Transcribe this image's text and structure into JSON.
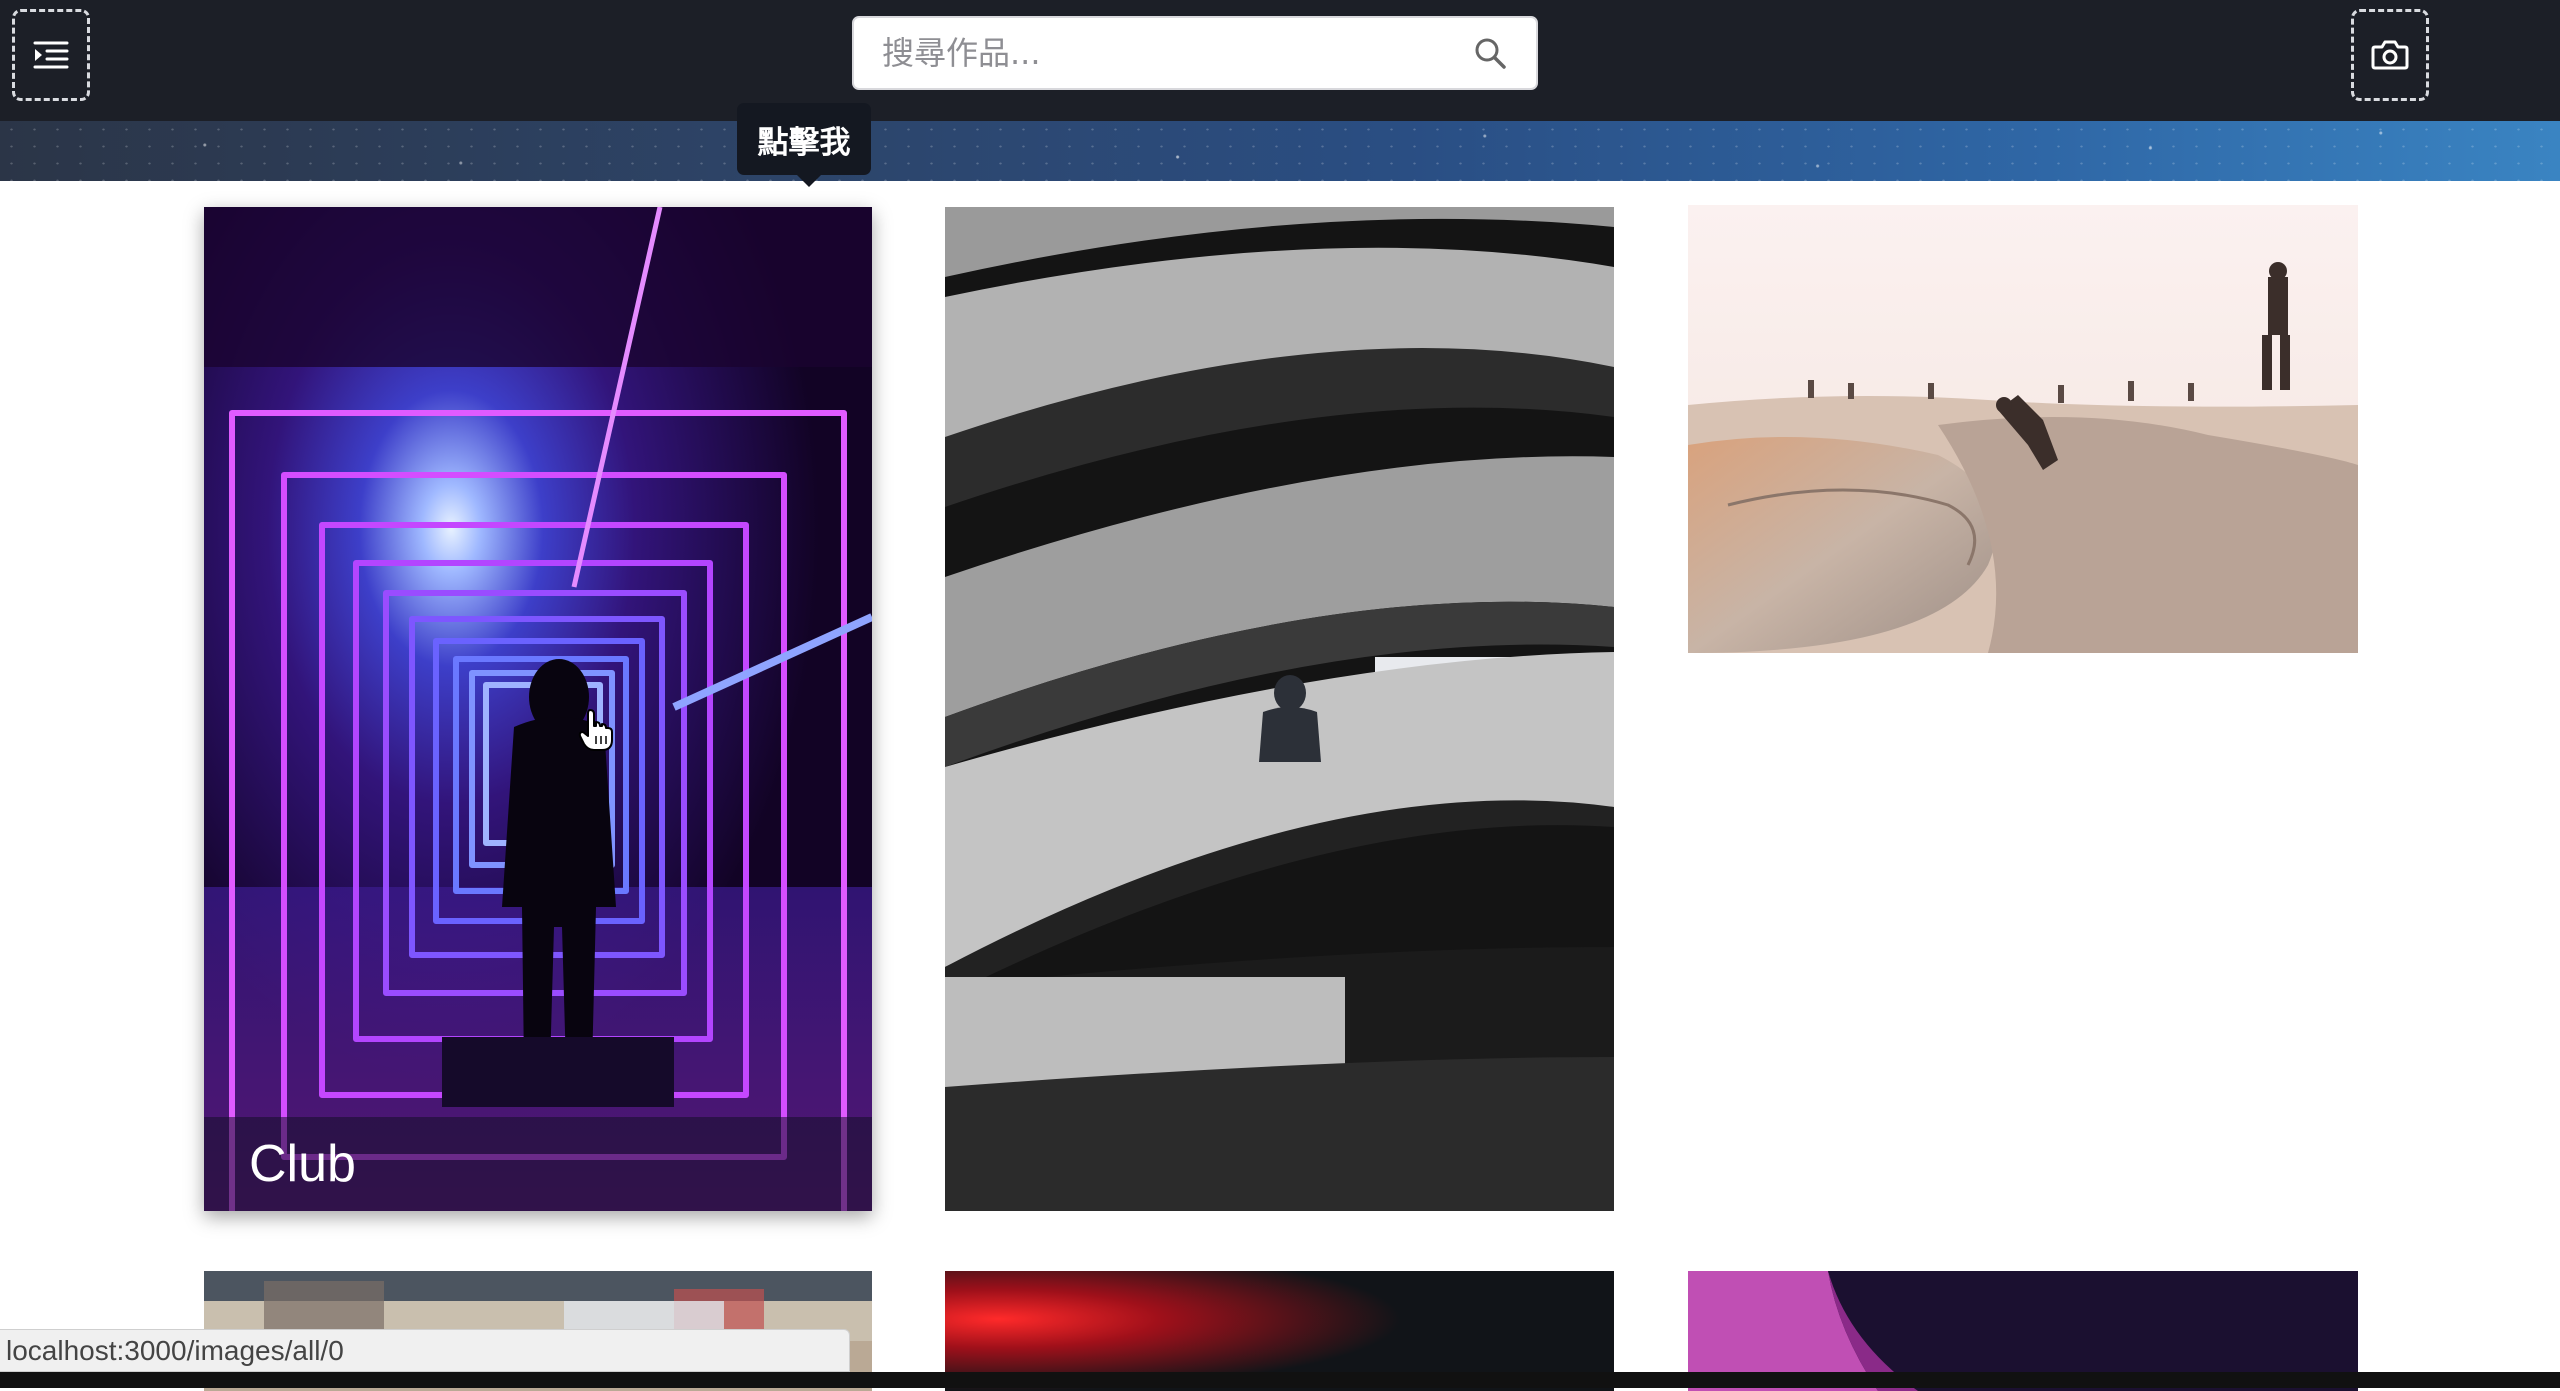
{
  "header": {
    "menu_icon": "menu-indent-icon",
    "camera_icon": "camera-icon",
    "search": {
      "placeholder": "搜尋作品...",
      "value": "",
      "icon": "search-icon"
    }
  },
  "tooltip": {
    "text": "點擊我"
  },
  "gallery": {
    "cards": [
      {
        "caption": "Club",
        "scene": "neon-purple-tunnel"
      },
      {
        "caption": "",
        "scene": "spiral-parking-garage"
      },
      {
        "caption": "",
        "scene": "skatepark-bowl"
      },
      {
        "caption": "",
        "scene": "blurred-city"
      },
      {
        "caption": "",
        "scene": "red-dark"
      },
      {
        "caption": "",
        "scene": "pink-portrait"
      }
    ]
  },
  "status_bar": {
    "url": "localhost:3000/images/all/0"
  },
  "colors": {
    "topbar_bg": "#1c1f27",
    "tooltip_bg": "#141821",
    "neon_purple": "#c43dff",
    "neon_blue": "#5a6cff"
  }
}
